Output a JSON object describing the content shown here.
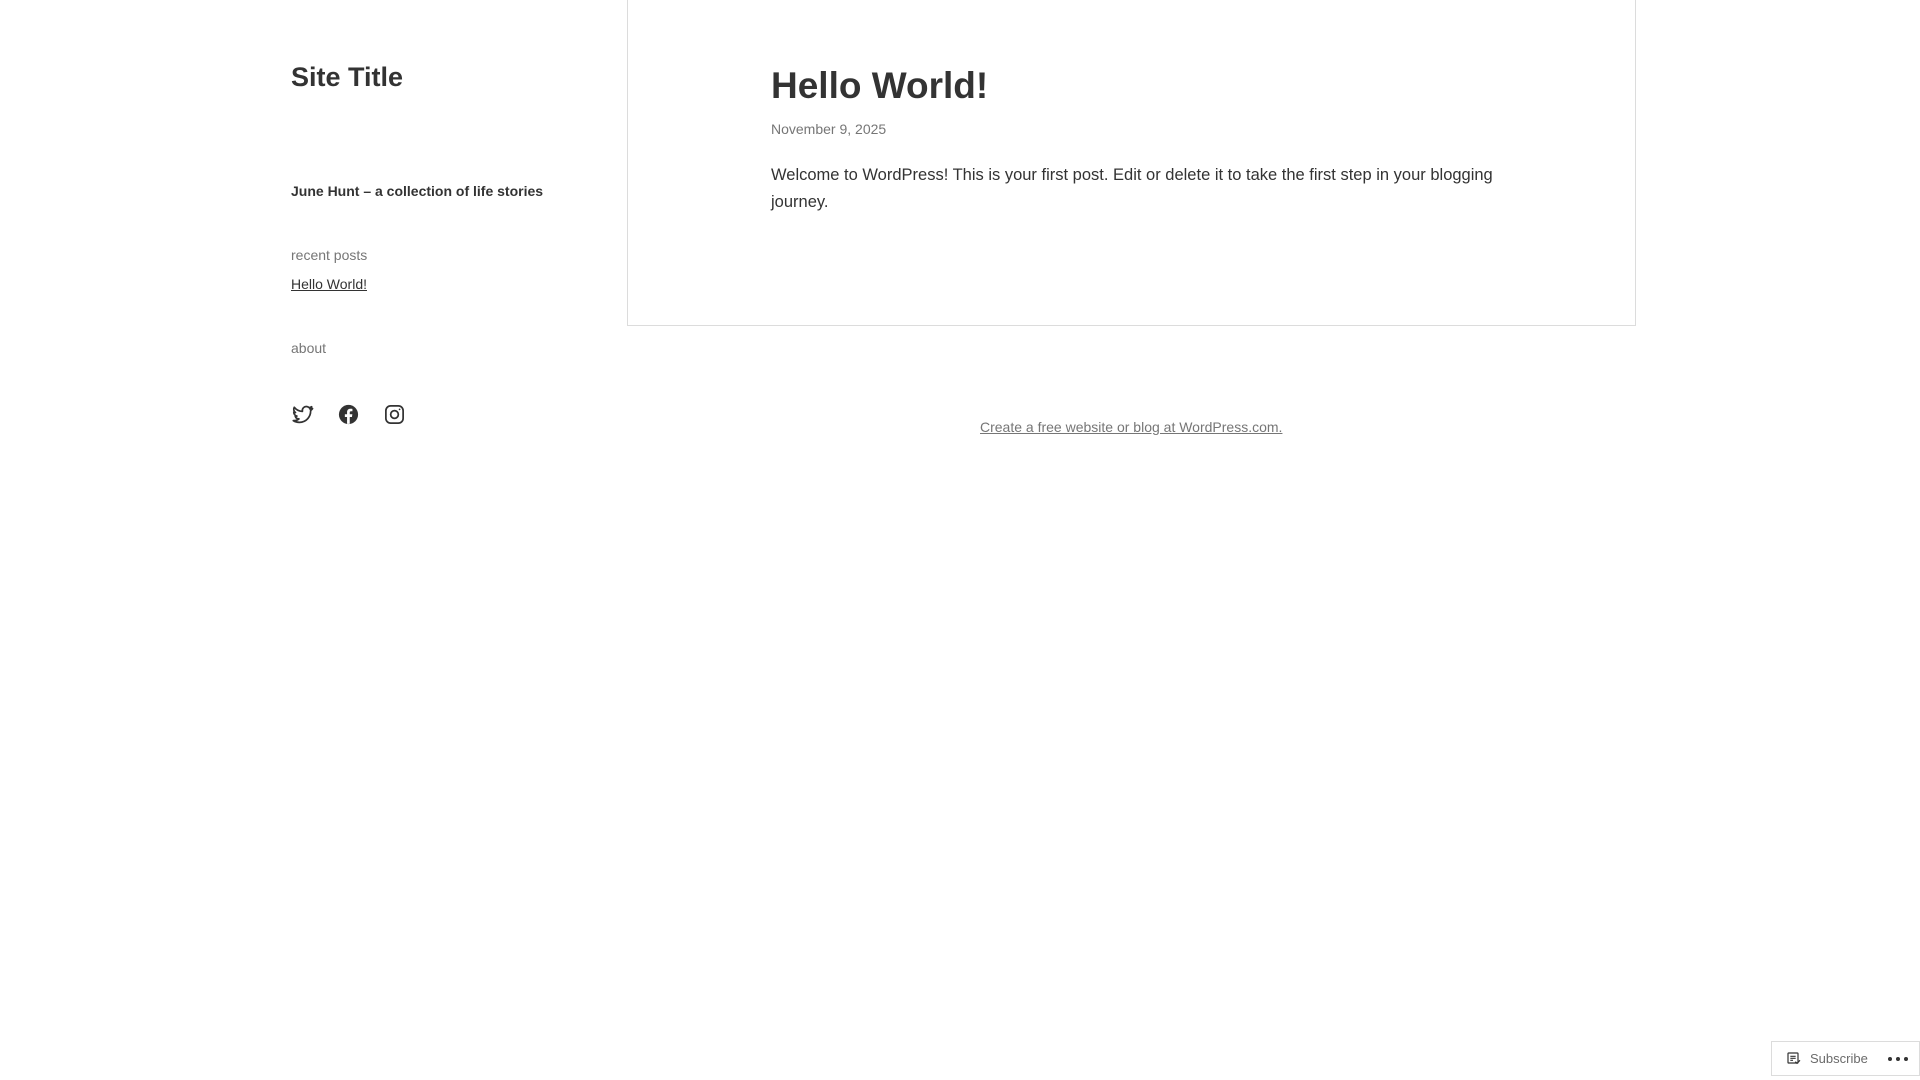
{
  "sidebar": {
    "site_title": "Site Title",
    "site_description": "June Hunt – a collection of life stories",
    "recent_posts": {
      "title": "recent posts",
      "items": [
        {
          "label": "Hello World!"
        }
      ]
    },
    "about": {
      "title": "about"
    },
    "social_icons": [
      "twitter-icon",
      "facebook-icon",
      "instagram-icon"
    ]
  },
  "post": {
    "title": "Hello World!",
    "date": "November 9, 2025",
    "content": "Welcome to WordPress! This is your first post. Edit or delete it to take the first step in your blogging journey."
  },
  "footer": {
    "credit": "Create a free website or blog at WordPress.com."
  },
  "subscribe": {
    "label": "Subscribe",
    "icons": [
      "reader-icon",
      "more-icon"
    ]
  },
  "colors": {
    "text": "#333333",
    "muted": "#767676",
    "border": "#dcdcdc",
    "background": "#ffffff"
  }
}
